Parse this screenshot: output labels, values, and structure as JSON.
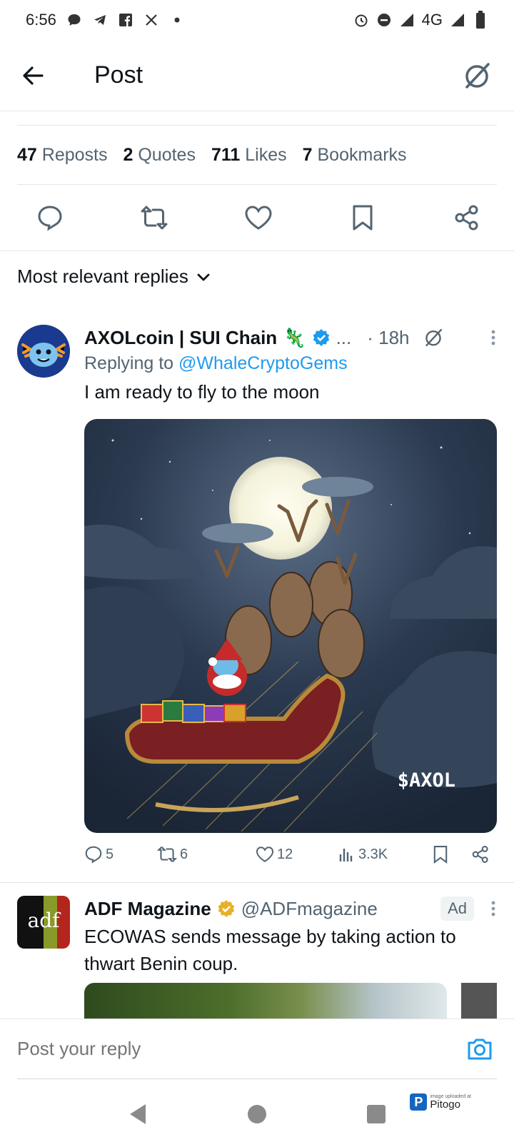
{
  "status_bar": {
    "time": "6:56",
    "network": "4G",
    "left_icons": [
      "chat-bubble-icon",
      "telegram-icon",
      "facebook-icon",
      "x-icon",
      "dot-icon"
    ],
    "right_icons": [
      "alarm-icon",
      "dnd-icon",
      "signal-icon",
      "signal-icon",
      "battery-icon"
    ]
  },
  "header": {
    "title": "Post",
    "back_icon": "arrow-left-icon",
    "grok_icon": "grok-icon"
  },
  "stats": [
    {
      "count": "47",
      "label": "Reposts"
    },
    {
      "count": "2",
      "label": "Quotes"
    },
    {
      "count": "711",
      "label": "Likes"
    },
    {
      "count": "7",
      "label": "Bookmarks"
    }
  ],
  "actions": [
    "reply-icon",
    "repost-icon",
    "like-icon",
    "bookmark-icon",
    "share-icon"
  ],
  "sort": {
    "label": "Most relevant replies"
  },
  "reply": {
    "name": "AXOLcoin | SUI Chain",
    "emoji": "🦎",
    "ellipsis": "...",
    "time": "· 18h",
    "replying_prefix": "Replying to",
    "replying_handle": "@WhaleCryptoGems",
    "text": "I am ready to fly to the moon",
    "image_caption": "$AXOL",
    "metrics": {
      "replies": "5",
      "reposts": "6",
      "likes": "12",
      "views": "3.3K"
    }
  },
  "ad": {
    "name": "ADF Magazine",
    "handle": "@ADFmagazine",
    "badge": "Ad",
    "text": "ECOWAS sends message by taking action to thwart Benin coup.",
    "avatar_text": "adf"
  },
  "composer": {
    "placeholder": "Post your reply"
  },
  "watermark": {
    "text": "Pitogo",
    "small": "image uploaded at"
  },
  "colors": {
    "accent": "#1d9bf0",
    "text": "#0f1419",
    "muted": "#536471",
    "verified_gold": "#e8b02a"
  }
}
